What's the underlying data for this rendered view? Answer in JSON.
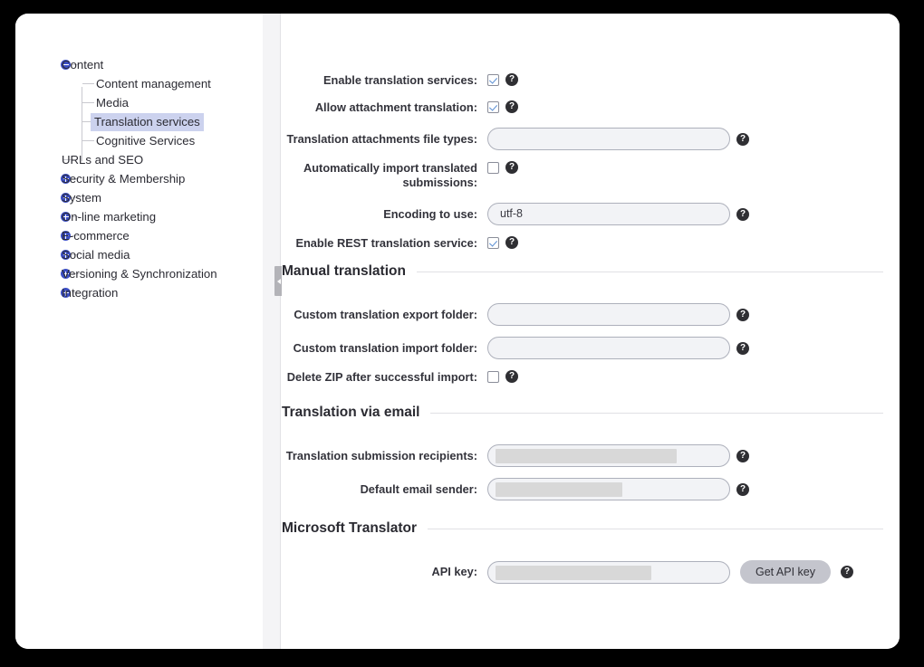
{
  "sidebar": {
    "items": [
      {
        "label": "Content",
        "level": 0,
        "toggle": "minus",
        "selected": false
      },
      {
        "label": "Content management",
        "level": 1,
        "toggle": "none",
        "selected": false
      },
      {
        "label": "Media",
        "level": 1,
        "toggle": "none",
        "selected": false
      },
      {
        "label": "Translation services",
        "level": 1,
        "toggle": "none",
        "selected": true
      },
      {
        "label": "Cognitive Services",
        "level": 1,
        "toggle": "none",
        "selected": false
      },
      {
        "label": "URLs and SEO",
        "level": 0,
        "toggle": "none",
        "selected": false
      },
      {
        "label": "Security & Membership",
        "level": 0,
        "toggle": "plus",
        "selected": false
      },
      {
        "label": "System",
        "level": 0,
        "toggle": "plus",
        "selected": false
      },
      {
        "label": "On-line marketing",
        "level": 0,
        "toggle": "plus",
        "selected": false
      },
      {
        "label": "E-commerce",
        "level": 0,
        "toggle": "plus",
        "selected": false
      },
      {
        "label": "Social media",
        "level": 0,
        "toggle": "plus",
        "selected": false
      },
      {
        "label": "Versioning & Synchronization",
        "level": 0,
        "toggle": "plus",
        "selected": false
      },
      {
        "label": "Integration",
        "level": 0,
        "toggle": "plus",
        "selected": false
      }
    ]
  },
  "splitter": {
    "handle_icon": "collapse-arrow-icon"
  },
  "settings": {
    "general": {
      "rows": [
        {
          "label": "Enable translation services:",
          "control": "checkbox",
          "checked": true,
          "help": "?"
        },
        {
          "label": "Allow attachment translation:",
          "control": "checkbox",
          "checked": true,
          "help": "?"
        },
        {
          "label": "Translation attachments file types:",
          "control": "input",
          "value": "",
          "placeholder": "",
          "redacted": false,
          "help": "?"
        },
        {
          "label": "Automatically import translated submissions:",
          "control": "checkbox",
          "checked": false,
          "help": "?"
        },
        {
          "label": "Encoding to use:",
          "control": "input",
          "value": "utf-8",
          "placeholder": "",
          "redacted": false,
          "help": "?"
        },
        {
          "label": "Enable REST translation service:",
          "control": "checkbox",
          "checked": true,
          "help": "?"
        }
      ]
    },
    "sections": [
      {
        "title": "Manual translation",
        "rows": [
          {
            "label": "Custom translation export folder:",
            "control": "input",
            "value": "",
            "placeholder": "",
            "redacted": false,
            "help": "?"
          },
          {
            "label": "Custom translation import folder:",
            "control": "input",
            "value": "",
            "placeholder": "",
            "redacted": false,
            "help": "?"
          },
          {
            "label": "Delete ZIP after successful import:",
            "control": "checkbox",
            "checked": false,
            "help": "?"
          }
        ]
      },
      {
        "title": "Translation via email",
        "rows": [
          {
            "label": "Translation submission recipients:",
            "control": "input",
            "value": "",
            "placeholder": "",
            "redacted": true,
            "redact_width": 200,
            "help": "?"
          },
          {
            "label": "Default email sender:",
            "control": "input",
            "value": "",
            "placeholder": "",
            "redacted": true,
            "redact_width": 140,
            "help": "?"
          }
        ]
      },
      {
        "title": "Microsoft Translator",
        "rows": [
          {
            "label": "API key:",
            "control": "input",
            "value": "",
            "placeholder": "",
            "redacted": true,
            "redact_width": 172,
            "button": "Get API key",
            "help": "?"
          }
        ]
      }
    ]
  },
  "colors": {
    "accent": "#3b4ec4",
    "selection": "#ccd2ee",
    "input_bg": "#f2f3f6",
    "input_border": "#adb0bb",
    "help_bg": "#2f2f33",
    "button_bg": "#c4c5cd",
    "check": "#5b8fd4",
    "redaction": "#d8d8d8"
  }
}
